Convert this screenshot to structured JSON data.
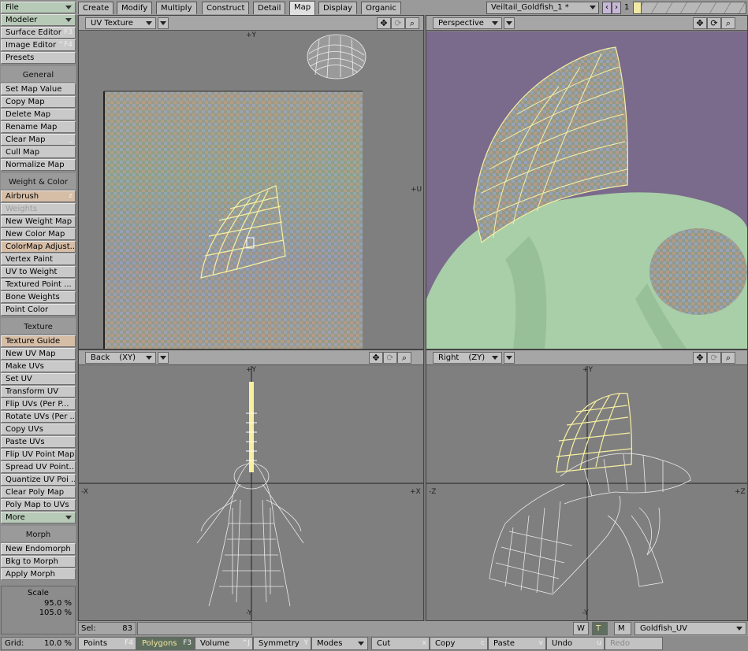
{
  "left_panel": {
    "file": "File",
    "modeler": "Modeler",
    "surface_editor": "Surface Editor",
    "surface_editor_key": "F3",
    "image_editor": "Image Editor",
    "image_editor_key": "^F4",
    "presets": "Presets",
    "general_header": "General",
    "general_items": [
      "Set Map Value",
      "Copy Map",
      "Delete Map",
      "Rename Map",
      "Clear Map",
      "Cull Map",
      "Normalize Map"
    ],
    "clear_map_key": "_",
    "weight_header": "Weight & Color",
    "airbrush": "Airbrush",
    "airbrush_key": "z",
    "weights": "Weights",
    "weight_items": [
      "New Weight Map",
      "New Color Map",
      "ColorMap Adjust...",
      "Vertex Paint",
      "UV to Weight",
      "Textured Point ...",
      "Bone Weights",
      "Point Color"
    ],
    "texture_header": "Texture",
    "texture_guide": "Texture Guide",
    "texture_items": [
      "New UV Map",
      "Make UVs",
      "Set UV",
      "Transform UV",
      "Flip UVs (Per P...",
      "Rotate UVs (Per ...",
      "Copy UVs",
      "Paste UVs",
      "Flip UV Point Map",
      "Spread UV Point...",
      "Quantize UV Poi ...",
      "Clear Poly Map",
      "Poly Map to UVs"
    ],
    "more": "More",
    "morph_header": "Morph",
    "morph_items": [
      "New Endomorph",
      "Bkg to Morph",
      "Apply Morph"
    ],
    "scale_label": "Scale",
    "scale_1": "95.0 %",
    "scale_2": "105.0 %",
    "grid_label": "Grid:",
    "grid_value": "10.0 %"
  },
  "tabs": [
    "Create",
    "Modify",
    "Multiply",
    "Construct",
    "Detail",
    "Map",
    "Display",
    "Organic"
  ],
  "active_tab": "Map",
  "object_name": "Veiltail_Goldfish_1 *",
  "layer_number": "1",
  "viewports": {
    "tl": {
      "label": "UV Texture",
      "axis_top": "+Y",
      "axis_right": "+U"
    },
    "tr": {
      "label": "Perspective"
    },
    "bl": {
      "label": "Back",
      "plane": "(XY)",
      "axis_top": "+Y",
      "axis_bottom": "-Y",
      "axis_left": "-X",
      "axis_right": "+X"
    },
    "br": {
      "label": "Right",
      "plane": "(ZY)",
      "axis_top": "+Y",
      "axis_bottom": "-Y",
      "axis_left": "-Z",
      "axis_right": "+Z"
    }
  },
  "status": {
    "sel_label": "Sel:",
    "sel_count": "83",
    "w": "W",
    "t": "T",
    "m": "M",
    "uv_map": "Goldfish_UV"
  },
  "toolbar": {
    "points": "Points",
    "points_key": "F4",
    "polygons": "Polygons",
    "polygons_key": "F3",
    "volume": "Volume",
    "volume_key": "^J",
    "symmetry": "Symmetry",
    "symmetry_key": "Y",
    "modes": "Modes",
    "cut": "Cut",
    "cut_key": "x",
    "copy": "Copy",
    "copy_key": "c",
    "paste": "Paste",
    "paste_key": "v",
    "undo": "Undo",
    "undo_key": "u",
    "redo": "Redo"
  },
  "colors": {
    "persp_bg": "#7a6a8c",
    "fish_green": "#a8cfa8",
    "wire_yellow": "#f7f0a0",
    "wire_white": "#f0f0f0"
  }
}
